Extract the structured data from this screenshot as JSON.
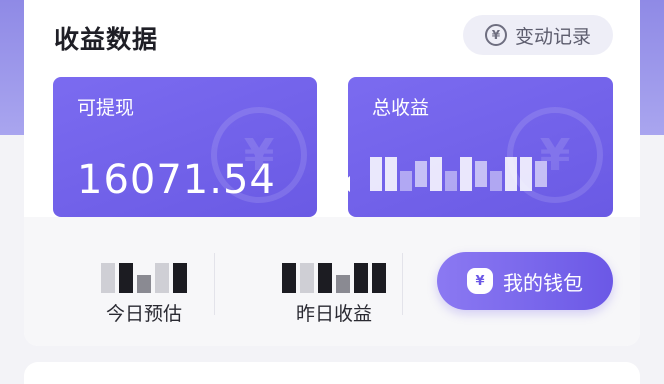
{
  "header": {
    "title": "收益数据",
    "history_button": "变动记录",
    "history_icon": "yen-circle-icon"
  },
  "tiles": {
    "withdrawable": {
      "label": "可提现",
      "value": "16071.54"
    },
    "total_earnings": {
      "label": "总收益",
      "value": ""
    }
  },
  "stats": {
    "today": {
      "label": "今日预估",
      "value": ""
    },
    "yesterday": {
      "label": "昨日收益",
      "value": ""
    }
  },
  "wallet": {
    "label": "我的钱包",
    "icon": "money-bag-icon"
  },
  "colors": {
    "accent": "#6b58e6",
    "tile_bg": "#7263ea",
    "band": "#9a95ea"
  }
}
